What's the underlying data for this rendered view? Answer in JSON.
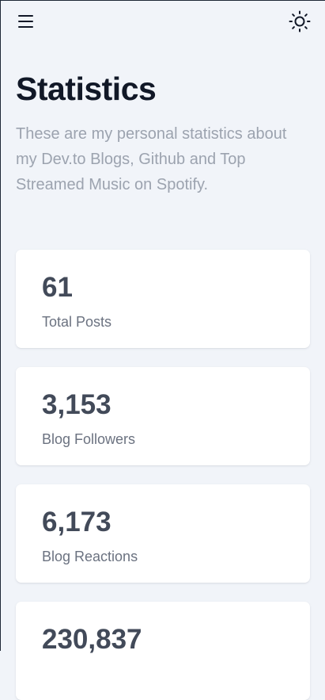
{
  "header": {
    "menu_icon": "hamburger-icon",
    "theme_icon": "sun-icon"
  },
  "page": {
    "title": "Statistics",
    "subtitle": "These are my personal statistics about my Dev.to Blogs, Github and Top Streamed Music on Spotify."
  },
  "stats": [
    {
      "value": "61",
      "label": "Total Posts"
    },
    {
      "value": "3,153",
      "label": "Blog Followers"
    },
    {
      "value": "6,173",
      "label": "Blog Reactions"
    },
    {
      "value": "230,837",
      "label": ""
    }
  ],
  "colors": {
    "background": "#f1f4f9",
    "card": "#ffffff",
    "title": "#111827",
    "subtitle": "#9ca3af",
    "stat_value": "#424a59",
    "stat_label": "#6b7280"
  }
}
